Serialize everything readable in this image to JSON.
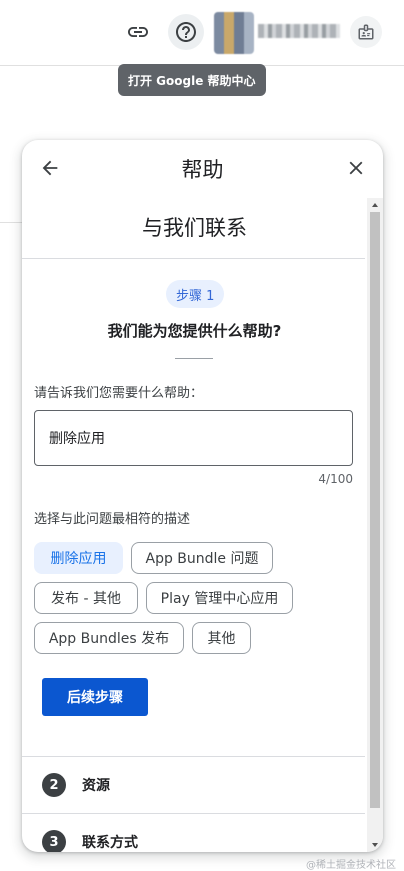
{
  "topbar": {
    "link_icon": "link-icon",
    "help_icon": "help-circle-icon",
    "badge_icon": "id-card-icon"
  },
  "tooltip": {
    "text": "打开 Google 帮助中心"
  },
  "panel": {
    "title": "帮助",
    "back_icon": "arrow-back-icon",
    "close_icon": "close-icon",
    "contact_title": "与我们联系",
    "step_pill": "步骤 1",
    "question": "我们能为您提供什么帮助?",
    "prompt_label": "请告诉我们您需要什么帮助：",
    "input_value": "删除应用",
    "char_count": "4/100",
    "choose_label": "选择与此问题最相符的描述",
    "chips": [
      {
        "label": "删除应用",
        "selected": true
      },
      {
        "label": "App Bundle 问题",
        "selected": false
      },
      {
        "label": "发布 - 其他",
        "selected": false
      },
      {
        "label": "Play 管理中心应用",
        "selected": false
      },
      {
        "label": "App Bundles 发布",
        "selected": false
      },
      {
        "label": "其他",
        "selected": false
      }
    ],
    "next_button": "后续步骤",
    "steps": [
      {
        "num": "2",
        "label": "资源"
      },
      {
        "num": "3",
        "label": "联系方式"
      }
    ]
  },
  "watermark": "@稀土掘金技术社区",
  "colors": {
    "accent": "#0b57d0",
    "chip_selected_bg": "#e8f0fe",
    "tooltip_bg": "#5f6368"
  }
}
